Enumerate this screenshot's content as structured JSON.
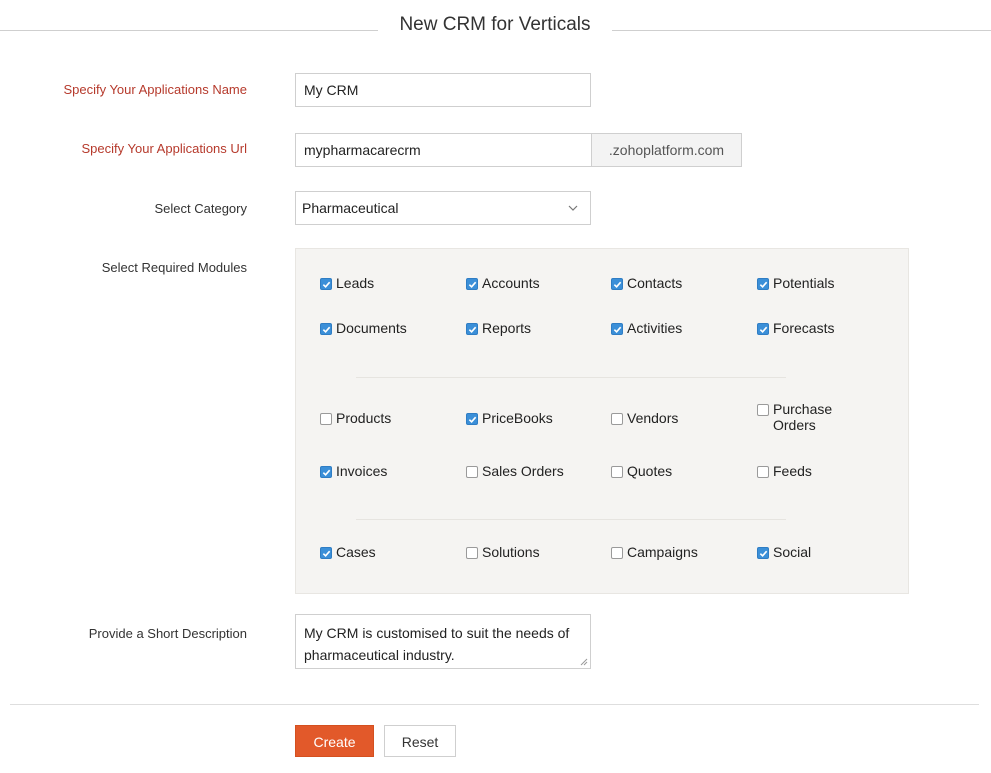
{
  "page": {
    "title": "New CRM for Verticals"
  },
  "form": {
    "app_name": {
      "label": "Specify Your Applications Name",
      "value": "My CRM"
    },
    "app_url": {
      "label": "Specify Your Applications Url",
      "value": "mypharmacarecrm",
      "suffix": ".zohoplatform.com"
    },
    "category": {
      "label": "Select Category",
      "selected": "Pharmaceutical"
    },
    "modules": {
      "label": "Select Required Modules",
      "items": [
        {
          "label": "Leads",
          "checked": true
        },
        {
          "label": "Accounts",
          "checked": true
        },
        {
          "label": "Contacts",
          "checked": true
        },
        {
          "label": "Potentials",
          "checked": true
        },
        {
          "label": "Documents",
          "checked": true
        },
        {
          "label": "Reports",
          "checked": true
        },
        {
          "label": "Activities",
          "checked": true
        },
        {
          "label": "Forecasts",
          "checked": true
        },
        {
          "label": "Products",
          "checked": false
        },
        {
          "label": "PriceBooks",
          "checked": true
        },
        {
          "label": "Vendors",
          "checked": false
        },
        {
          "label": "Purchase Orders",
          "checked": false
        },
        {
          "label": "Invoices",
          "checked": true
        },
        {
          "label": "Sales Orders",
          "checked": false
        },
        {
          "label": "Quotes",
          "checked": false
        },
        {
          "label": "Feeds",
          "checked": false
        },
        {
          "label": "Cases",
          "checked": true
        },
        {
          "label": "Solutions",
          "checked": false
        },
        {
          "label": "Campaigns",
          "checked": false
        },
        {
          "label": "Social",
          "checked": true
        }
      ]
    },
    "description": {
      "label": "Provide a Short Description",
      "value": "My CRM is customised to suit the needs of pharmaceutical industry."
    }
  },
  "actions": {
    "create_label": "Create",
    "reset_label": "Reset"
  },
  "colors": {
    "required_label": "#b63a2c",
    "checkbox_checked": "#3b8fd8",
    "create_button": "#e2592a",
    "modules_panel_bg": "#f5f4f2"
  }
}
